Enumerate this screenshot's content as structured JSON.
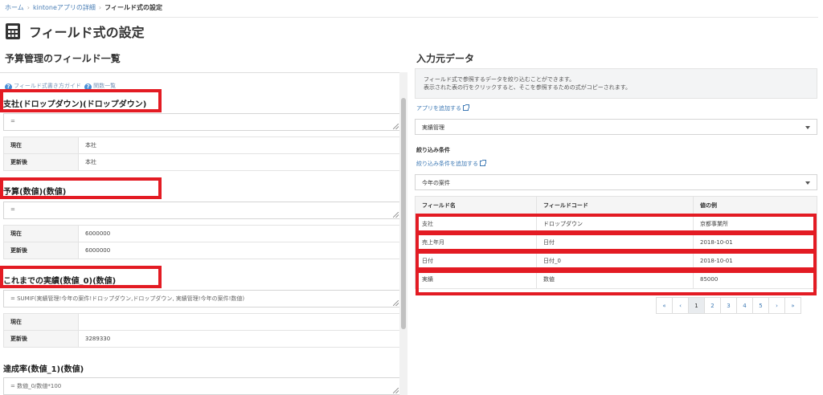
{
  "breadcrumb": {
    "home": "ホーム",
    "app_detail": "kintoneアプリの詳細",
    "current": "フィールド式の設定"
  },
  "page": {
    "title": "フィールド式の設定",
    "icon": "calculator-icon"
  },
  "left": {
    "heading": "予算管理のフィールド一覧",
    "guide_link": "フィールド式書き方ガイド",
    "func_link": "関数一覧",
    "fields": [
      {
        "title": "支社(ドロップダウン)(ドロップダウン)",
        "formula": "=",
        "rows": [
          {
            "k": "現在",
            "v": "本社"
          },
          {
            "k": "更新後",
            "v": "本社"
          }
        ]
      },
      {
        "title": "予算(数値)(数値)",
        "formula": "=",
        "rows": [
          {
            "k": "現在",
            "v": "6000000"
          },
          {
            "k": "更新後",
            "v": "6000000"
          }
        ]
      },
      {
        "title": "これまでの実績(数値_0)(数値)",
        "formula": "= SUMIF(実績管理!今年の案件!ドロップダウン,ドロップダウン, 実績管理!今年の案件!数値)",
        "rows": [
          {
            "k": "現在",
            "v": ""
          },
          {
            "k": "更新後",
            "v": "3289330"
          }
        ]
      },
      {
        "title": "達成率(数値_1)(数値)",
        "formula": "= 数値_0/数値*100"
      }
    ]
  },
  "right": {
    "heading": "入力元データ",
    "info_line1": "フィールド式で参照するデータを絞り込むことができます。",
    "info_line2": "表示された表の行をクリックすると、そこを参照するための式がコピーされます。",
    "add_app_link": "アプリを追加する",
    "app_select": "実績管理",
    "filter_label": "絞り込み条件",
    "add_filter_link": "絞り込み条件を追加する",
    "filter_select": "今年の案件",
    "table": {
      "headers": [
        "フィールド名",
        "フィールドコード",
        "値の例"
      ],
      "rows": [
        [
          "支社",
          "ドロップダウン",
          "京都事業所"
        ],
        [
          "売上年月",
          "日付",
          "2018-10-01"
        ],
        [
          "日付",
          "日付_0",
          "2018-10-01"
        ],
        [
          "実績",
          "数値",
          "85000"
        ]
      ]
    },
    "pagination": [
      "«",
      "‹",
      "1",
      "2",
      "3",
      "4",
      "5",
      "›",
      "»"
    ],
    "active_page": "1"
  },
  "colors": {
    "highlight": "#e31b23",
    "link": "#3c78b4"
  }
}
